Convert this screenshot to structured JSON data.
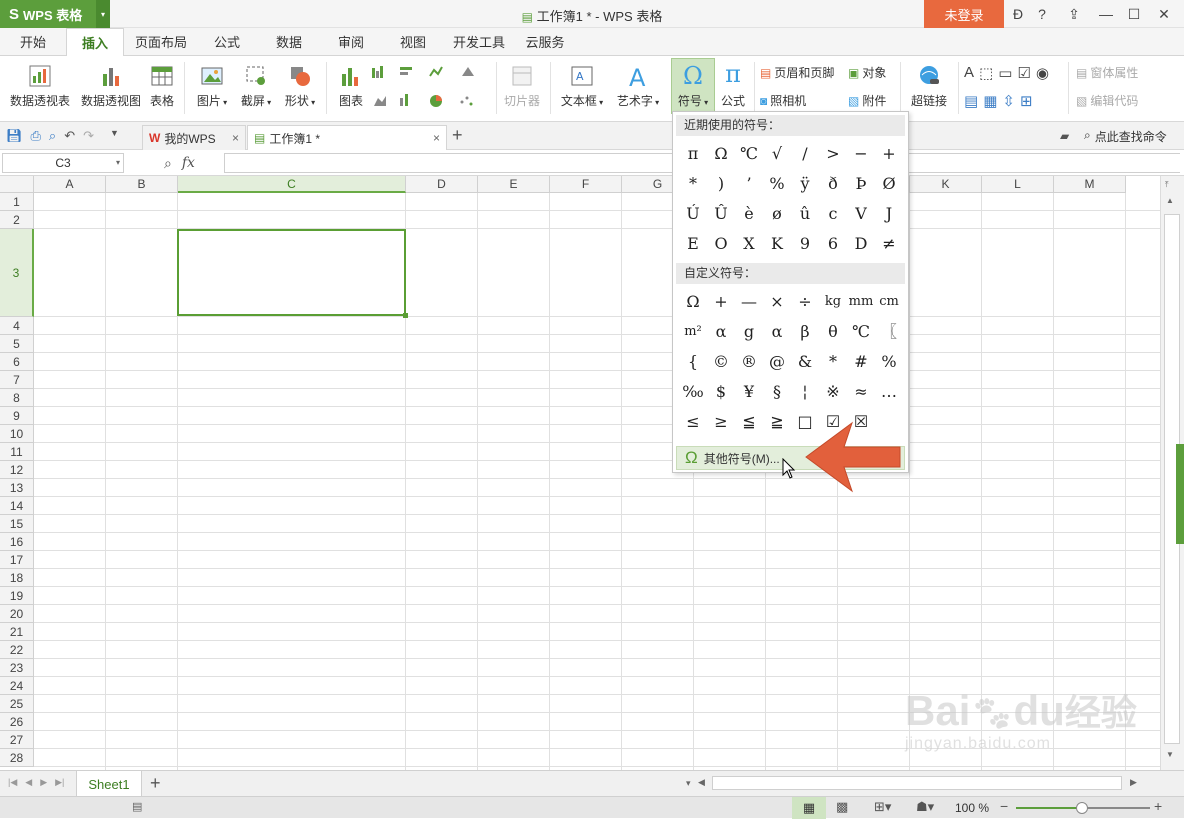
{
  "titlebar": {
    "app_name": "WPS 表格",
    "window_title": "工作簿1 * - WPS 表格",
    "login": "未登录",
    "help": "?"
  },
  "menu_tabs": [
    "开始",
    "插入",
    "页面布局",
    "公式",
    "数据",
    "审阅",
    "视图",
    "开发工具",
    "云服务"
  ],
  "active_tab": "插入",
  "ribbon": {
    "pivot_table": "数据透视表",
    "pivot_chart": "数据透视图",
    "table": "表格",
    "picture": "图片",
    "screenshot": "截屏",
    "shape": "形状",
    "chart": "图表",
    "slicer": "切片器",
    "textbox": "文本框",
    "wordart": "艺术字",
    "symbol": "符号",
    "formula": "公式",
    "header_footer": "页眉和页脚",
    "object": "对象",
    "camera": "照相机",
    "attachment": "附件",
    "hyperlink": "超链接",
    "window_props": "窗体属性",
    "edit_code": "编辑代码"
  },
  "doc_tabs": {
    "mywps": "我的WPS",
    "workbook": "工作簿1 *",
    "search": "点此查找命令"
  },
  "formula_bar": {
    "cell_ref": "C3",
    "fx": "fx",
    "content": ""
  },
  "columns": [
    "A",
    "B",
    "C",
    "D",
    "E",
    "F",
    "G",
    "H",
    "I",
    "J",
    "K",
    "L",
    "M"
  ],
  "rows": [
    "1",
    "2",
    "3",
    "4",
    "5",
    "6",
    "7",
    "8",
    "9",
    "10",
    "11",
    "12",
    "13",
    "14",
    "15",
    "16",
    "17",
    "18",
    "19",
    "20",
    "21",
    "22",
    "23",
    "24",
    "25",
    "26",
    "27",
    "28"
  ],
  "symbol_dropdown": {
    "recent_header": "近期使用的符号：",
    "recent": [
      "π",
      "Ω",
      "℃",
      "√",
      "/",
      ">",
      "−",
      "+",
      "*",
      ")",
      "’",
      "%",
      "ÿ",
      "ð",
      "Þ",
      "Ø",
      "Ú",
      "Û",
      "è",
      "ø",
      "û",
      "c",
      "V",
      "J",
      "E",
      "O",
      "X",
      "K",
      "9",
      "6",
      "D",
      "≠"
    ],
    "custom_header": "自定义符号：",
    "custom": [
      "Ω",
      "+",
      "—",
      "×",
      "÷",
      "kg",
      "mm",
      "cm",
      "m²",
      "α",
      "g",
      "α",
      "β",
      "θ",
      "℃",
      "〖",
      "{",
      "©",
      "®",
      "@",
      "&",
      "*",
      "#",
      "%",
      "‰",
      "$",
      "¥",
      "§",
      "¦",
      "※",
      "≈",
      "…",
      "≤",
      "≥",
      "≦",
      "≧",
      "□",
      "☑",
      "☒",
      ""
    ],
    "more": "其他符号(M)..."
  },
  "sheet_tabs": [
    "Sheet1"
  ],
  "status": {
    "zoom": "100 %"
  },
  "watermark": {
    "brand": "Bai",
    "brand2": "du",
    "brand3": "经验",
    "url": "jingyan.baidu.com"
  },
  "colors": {
    "accent_green": "#5c9e3c",
    "login_orange": "#e8693e",
    "arrow": "#e2603c"
  }
}
